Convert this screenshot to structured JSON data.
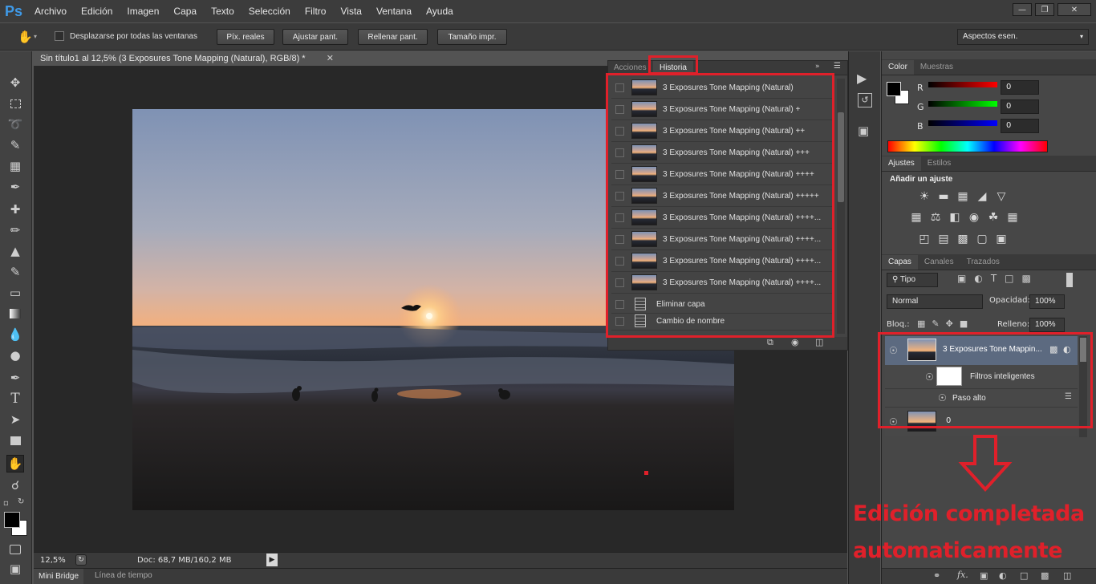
{
  "app": {
    "logo": "Ps",
    "colors": {
      "annotation_red": "#e0202a",
      "accent_blue": "#3f9ae8"
    }
  },
  "menubar": {
    "items": [
      "Archivo",
      "Edición",
      "Imagen",
      "Capa",
      "Texto",
      "Selección",
      "Filtro",
      "Vista",
      "Ventana",
      "Ayuda"
    ]
  },
  "options": {
    "scroll_all_label": "Desplazarse por todas las ventanas",
    "btn_actual": "Píx. reales",
    "btn_fit": "Ajustar pant.",
    "btn_fill": "Rellenar pant.",
    "btn_print": "Tamaño impr.",
    "workspace": "Aspectos esen."
  },
  "document": {
    "tab_title": "Sin título1 al 12,5% (3 Exposures Tone Mapping (Natural), RGB/8) *"
  },
  "status": {
    "zoom": "12,5%",
    "doc": "Doc: 68,7 MB/160,2 MB"
  },
  "bottom_tabs": [
    "Mini Bridge",
    "Línea de tiempo"
  ],
  "history_panel": {
    "tabs": [
      "Acciones",
      "Historia"
    ],
    "items": [
      "3 Exposures Tone Mapping (Natural)",
      "3 Exposures Tone Mapping (Natural) +",
      "3 Exposures Tone Mapping (Natural) ++",
      "3 Exposures Tone Mapping (Natural) +++",
      "3 Exposures Tone Mapping (Natural) ++++",
      "3 Exposures Tone Mapping (Natural) +++++",
      "3 Exposures Tone Mapping (Natural) ++++...",
      "3 Exposures Tone Mapping (Natural) ++++...",
      "3 Exposures Tone Mapping (Natural) ++++...",
      "3 Exposures Tone Mapping (Natural) ++++..."
    ],
    "doc_items": [
      "Eliminar capa",
      "Cambio de nombre"
    ]
  },
  "color_panel": {
    "tabs": [
      "Color",
      "Muestras"
    ],
    "channels": [
      {
        "name": "R",
        "value": "0"
      },
      {
        "name": "G",
        "value": "0"
      },
      {
        "name": "B",
        "value": "0"
      }
    ]
  },
  "adjust_panel": {
    "tabs": [
      "Ajustes",
      "Estilos"
    ],
    "title": "Añadir un ajuste"
  },
  "layers_panel": {
    "tabs": [
      "Capas",
      "Canales",
      "Trazados"
    ],
    "filter": "Tipo",
    "blend": "Normal",
    "opacity_label": "Opacidad:",
    "opacity": "100%",
    "lock_label": "Bloq.:",
    "fill_label": "Relleno:",
    "fill": "100%",
    "layers": [
      {
        "name": "3 Exposures Tone Mappin..."
      },
      {
        "name": "Filtros inteligentes"
      },
      {
        "name": "Paso alto"
      },
      {
        "name": "0"
      }
    ]
  },
  "annotation": {
    "line1": "Edición completada",
    "line2": "automaticamente"
  }
}
